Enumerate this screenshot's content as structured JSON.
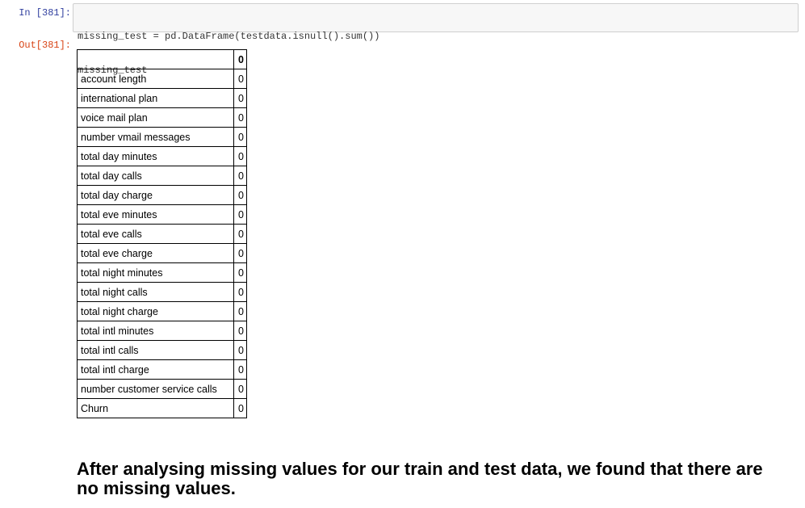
{
  "input_cell": {
    "prompt": "In [381]:",
    "code_lines": [
      "missing_test = pd.DataFrame(testdata.isnull().sum())",
      "missing_test"
    ]
  },
  "output_cell": {
    "prompt": "Out[381]:",
    "table": {
      "column_header": "0",
      "rows": [
        {
          "label": "account length",
          "value": "0"
        },
        {
          "label": "international plan",
          "value": "0"
        },
        {
          "label": "voice mail plan",
          "value": "0"
        },
        {
          "label": "number vmail messages",
          "value": "0"
        },
        {
          "label": "total day minutes",
          "value": "0"
        },
        {
          "label": "total day calls",
          "value": "0"
        },
        {
          "label": "total day charge",
          "value": "0"
        },
        {
          "label": "total eve minutes",
          "value": "0"
        },
        {
          "label": "total eve calls",
          "value": "0"
        },
        {
          "label": "total eve charge",
          "value": "0"
        },
        {
          "label": "total night minutes",
          "value": "0"
        },
        {
          "label": "total night calls",
          "value": "0"
        },
        {
          "label": "total night charge",
          "value": "0"
        },
        {
          "label": "total intl minutes",
          "value": "0"
        },
        {
          "label": "total intl calls",
          "value": "0"
        },
        {
          "label": "total intl charge",
          "value": "0"
        },
        {
          "label": "number customer service calls",
          "value": "0"
        },
        {
          "label": "Churn",
          "value": "0"
        }
      ]
    }
  },
  "markdown_cell": {
    "text": "After analysing missing values for our train and test data, we found that there are no missing values."
  },
  "colors": {
    "in_prompt": "#303f9f",
    "out_prompt": "#d84315",
    "code_background": "#f7f7f7",
    "code_border": "#cfcfcf"
  }
}
